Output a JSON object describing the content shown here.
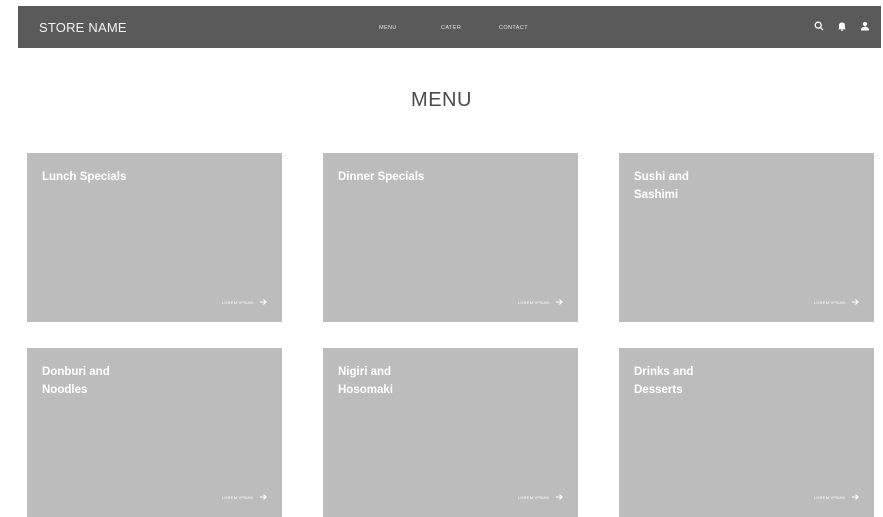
{
  "header": {
    "brand": "STORE NAME",
    "nav": [
      {
        "label": "MENU"
      },
      {
        "label": "CATER"
      },
      {
        "label": "CONTACT"
      }
    ],
    "icons": [
      "search-icon",
      "bell-icon",
      "user-icon"
    ]
  },
  "main": {
    "title": "MENU",
    "cards": [
      {
        "title": "Lunch Specials",
        "link": "LOREM IPSUM"
      },
      {
        "title": "Dinner Specials",
        "link": "LOREM IPSUM"
      },
      {
        "title": "Sushi and\nSashimi",
        "link": "LOREM IPSUM"
      },
      {
        "title": "Donburi and\nNoodles",
        "link": "LOREM IPSUM"
      },
      {
        "title": "Nigiri and\nHosomaki",
        "link": "LOREM IPSUM"
      },
      {
        "title": "Drinks and\nDesserts",
        "link": "LOREM IPSUM"
      }
    ]
  },
  "colors": {
    "navbar": "#5a5a5a",
    "card": "#bcbcbc",
    "title_text": "#4a4a4a"
  }
}
